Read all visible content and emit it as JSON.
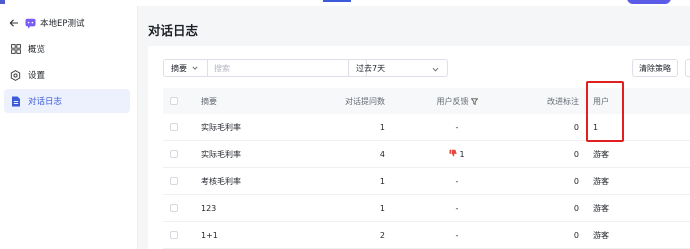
{
  "app": {
    "name": "本地EP测试"
  },
  "nav": [
    {
      "key": "overview",
      "label": "概览",
      "icon": "grid-icon"
    },
    {
      "key": "settings",
      "label": "设置",
      "icon": "gear-icon"
    },
    {
      "key": "logs",
      "label": "对话日志",
      "icon": "document-icon",
      "active": true
    }
  ],
  "page": {
    "title": "对话日志"
  },
  "filters": {
    "field_label": "摘要",
    "search_placeholder": "搜索",
    "date_range": "过去7天",
    "clear_strategy": "清除策略"
  },
  "table": {
    "columns": {
      "summary": "摘要",
      "count": "对话提问数",
      "feedback": "用户反馈",
      "mark": "改进标注",
      "user": "用户"
    },
    "rows": [
      {
        "summary": "实际毛利率",
        "count": "1",
        "feedback": "-",
        "feedback_icon": "",
        "mark": "0",
        "user": "1"
      },
      {
        "summary": "实际毛利率",
        "count": "4",
        "feedback": "1",
        "feedback_icon": "thumbs-down-icon",
        "mark": "0",
        "user": "游客"
      },
      {
        "summary": "考核毛利率",
        "count": "1",
        "feedback": "-",
        "feedback_icon": "",
        "mark": "0",
        "user": "游客"
      },
      {
        "summary": "123",
        "count": "1",
        "feedback": "-",
        "feedback_icon": "",
        "mark": "0",
        "user": "游客"
      },
      {
        "summary": "1+1",
        "count": "2",
        "feedback": "-",
        "feedback_icon": "",
        "mark": "0",
        "user": "游客"
      }
    ]
  },
  "colors": {
    "accent": "#3b5bdb",
    "active_nav_bg": "#edf1fd",
    "thumb_down": "#e8453c",
    "highlight_box": "#e02020"
  }
}
